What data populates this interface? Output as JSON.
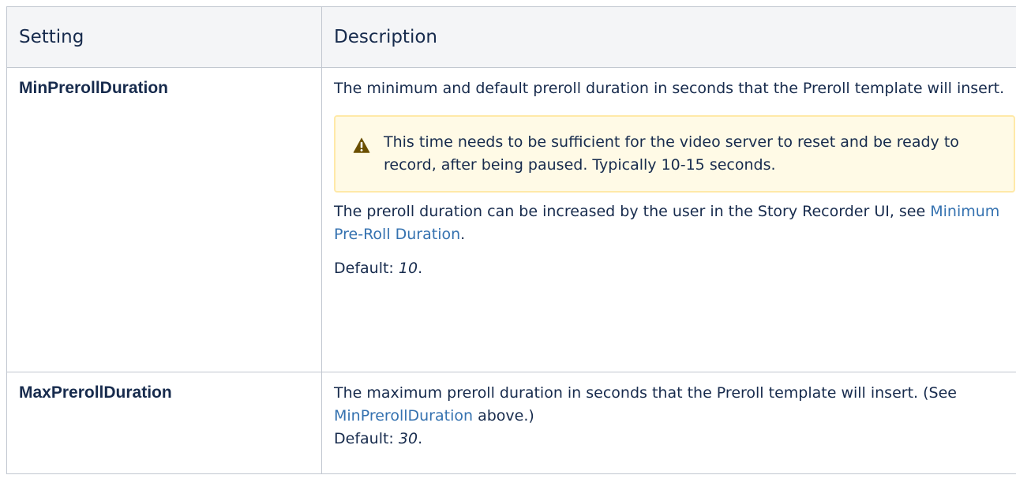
{
  "table": {
    "headers": {
      "setting": "Setting",
      "description": "Description"
    },
    "rows": [
      {
        "setting": "MinPrerollDuration",
        "desc_intro": "The minimum and default preroll duration in seconds that the Preroll template will insert.",
        "warning": {
          "icon": "warning-icon",
          "text": "This time needs to be sufficient for the video server to reset and be ready to record, after being paused. Typically 10-15 seconds."
        },
        "desc_more_prefix": "The preroll duration can be increased by the user in the Story Recorder UI, see ",
        "desc_more_link": "Minimum Pre-Roll Duration",
        "desc_more_suffix": ".",
        "default_label": "Default: ",
        "default_value": "10",
        "default_suffix": "."
      },
      {
        "setting": "MaxPrerollDuration",
        "desc_prefix": "The maximum preroll duration in seconds that the Preroll template will insert. (See ",
        "desc_link": "MinPrerollDuration",
        "desc_suffix": " above.)",
        "default_label": "Default: ",
        "default_value": "30",
        "default_suffix": "."
      }
    ]
  },
  "colors": {
    "link": "#3572b0",
    "warning_bg": "#fffae6",
    "warning_border": "#ffe9a8",
    "header_bg": "#f4f5f7",
    "border": "#c1c7d0",
    "warning_icon": "#6b4f00"
  }
}
